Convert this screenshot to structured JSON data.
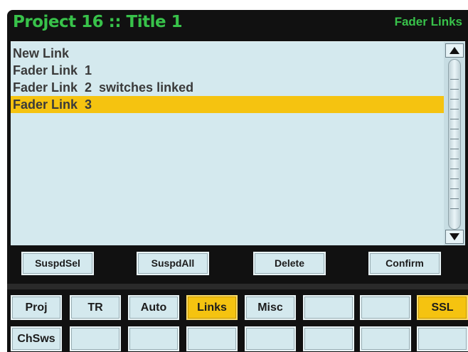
{
  "header": {
    "project_title": "Project 16 :: Title 1",
    "page_name": "Fader Links"
  },
  "list": {
    "items": [
      {
        "label": "New Link",
        "selected": false
      },
      {
        "label": "Fader Link  1",
        "selected": false
      },
      {
        "label": "Fader Link  2  switches linked",
        "selected": false
      },
      {
        "label": "Fader Link  3",
        "selected": true
      }
    ]
  },
  "scrollbar": {
    "up_icon": "triangle-up-icon",
    "down_icon": "triangle-down-icon"
  },
  "softkeys": {
    "suspd_sel": "SuspdSel",
    "suspd_all": "SuspdAll",
    "delete": "Delete",
    "confirm": "Confirm"
  },
  "tabs": {
    "row1": [
      "Proj",
      "TR",
      "Auto",
      "Links",
      "Misc",
      "",
      "",
      "SSL"
    ],
    "row2": [
      "ChSws",
      "",
      "",
      "",
      "",
      "",
      "",
      ""
    ],
    "active": [
      "Links",
      "SSL"
    ]
  },
  "colors": {
    "title_green": "#38c24a",
    "highlight_yellow": "#f5c310",
    "panel_blue": "#d4e9ee",
    "background": "#111111"
  }
}
